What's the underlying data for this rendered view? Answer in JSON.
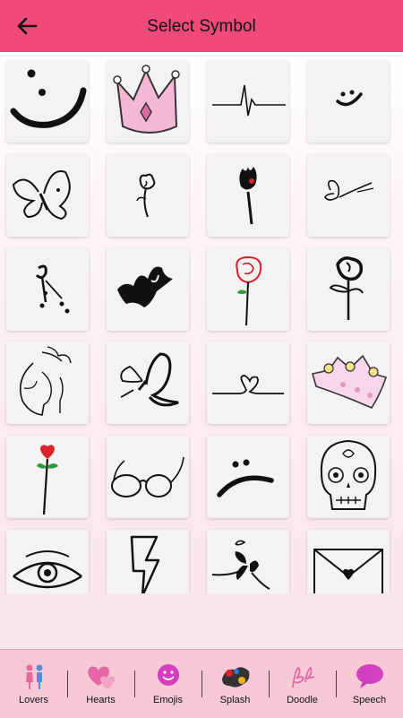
{
  "header": {
    "title": "Select Symbol",
    "back_icon": "arrow-left-icon"
  },
  "colors": {
    "header": "#ef4a7a",
    "bottom_bar": "#f7c9d6",
    "background": "#fbe6ec"
  },
  "symbols": [
    "smiley-doodle",
    "crown-pink",
    "heartbeat-line",
    "small-smiley",
    "butterfly-outline",
    "small-flower",
    "tulip",
    "flying-butterfly",
    "floral-sprig",
    "crown-black",
    "red-rose",
    "flower-stem",
    "face-sketch",
    "butterfly-swirl",
    "heart-line",
    "crown-tilted",
    "heart-rose-stem",
    "glasses",
    "sad-face",
    "sugar-skull",
    "eye",
    "lightning-bolt",
    "butterfly-flourish",
    "love-envelope"
  ],
  "tabs": [
    {
      "label": "Lovers",
      "icon": "lovers-icon"
    },
    {
      "label": "Hearts",
      "icon": "hearts-icon"
    },
    {
      "label": "Emojis",
      "icon": "emoji-icon"
    },
    {
      "label": "Splash",
      "icon": "splash-icon"
    },
    {
      "label": "Doodle",
      "icon": "doodle-icon"
    },
    {
      "label": "Speech",
      "icon": "speech-bubble-icon"
    }
  ]
}
